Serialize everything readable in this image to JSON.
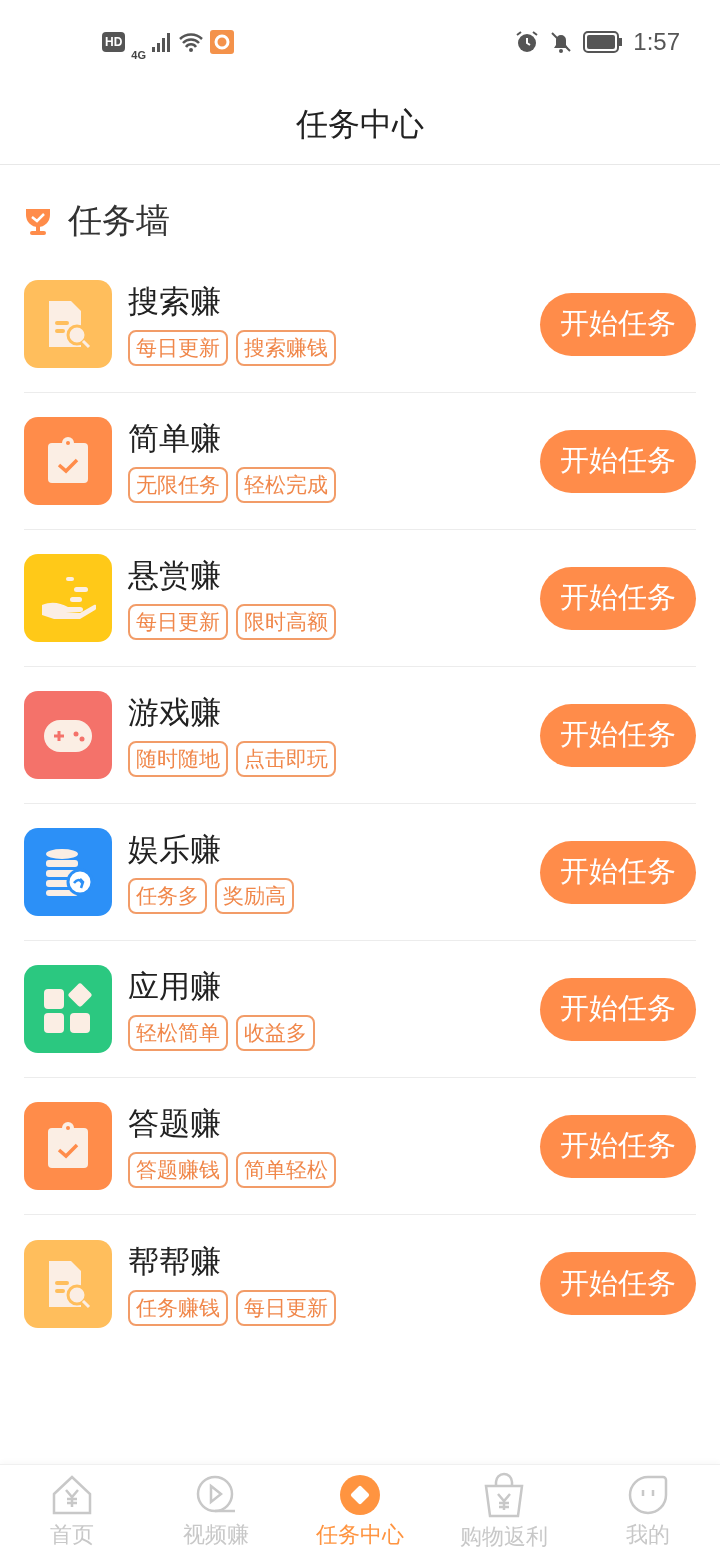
{
  "status_bar": {
    "hd": "HD",
    "network": "4G",
    "time": "1:57"
  },
  "header": {
    "title": "任务中心"
  },
  "section": {
    "title": "任务墙"
  },
  "tasks": [
    {
      "name": "搜索赚",
      "kind": "search-doc",
      "color": "#ffbe5c",
      "tags": [
        "每日更新",
        "搜索赚钱"
      ],
      "button": "开始任务"
    },
    {
      "name": "简单赚",
      "kind": "clipboard",
      "color": "#ff8c4a",
      "tags": [
        "无限任务",
        "轻松完成"
      ],
      "button": "开始任务"
    },
    {
      "name": "悬赏赚",
      "kind": "hand",
      "color": "#ffc918",
      "tags": [
        "每日更新",
        "限时高额"
      ],
      "button": "开始任务"
    },
    {
      "name": "游戏赚",
      "kind": "gamepad",
      "color": "#f4726a",
      "tags": [
        "随时随地",
        "点击即玩"
      ],
      "button": "开始任务"
    },
    {
      "name": "娱乐赚",
      "kind": "coins",
      "color": "#2c90f7",
      "tags": [
        "任务多",
        "奖励高"
      ],
      "button": "开始任务"
    },
    {
      "name": "应用赚",
      "kind": "apps",
      "color": "#2bc880",
      "tags": [
        "轻松简单",
        "收益多"
      ],
      "button": "开始任务"
    },
    {
      "name": "答题赚",
      "kind": "clipboard",
      "color": "#ff8c4a",
      "tags": [
        "答题赚钱",
        "简单轻松"
      ],
      "button": "开始任务"
    },
    {
      "name": "帮帮赚",
      "kind": "search-doc",
      "color": "#ffbe5c",
      "tags": [
        "任务赚钱",
        "每日更新"
      ],
      "button": "开始任务"
    }
  ],
  "nav": [
    {
      "label": "首页",
      "kind": "home",
      "selected": false
    },
    {
      "label": "视频赚",
      "kind": "play",
      "selected": false
    },
    {
      "label": "任务中心",
      "kind": "diamond",
      "selected": true
    },
    {
      "label": "购物返利",
      "kind": "bag",
      "selected": false
    },
    {
      "label": "我的",
      "kind": "face",
      "selected": false
    }
  ]
}
